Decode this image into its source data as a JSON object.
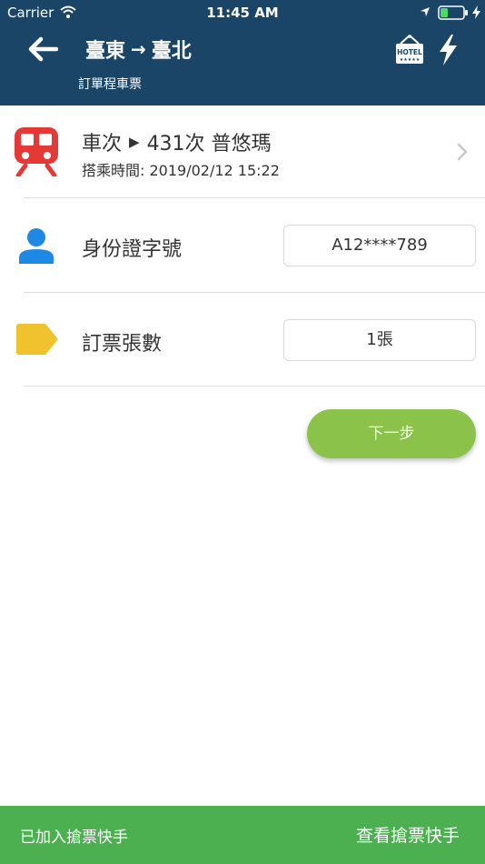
{
  "status_bar": {
    "carrier": "Carrier",
    "time": "11:45 AM"
  },
  "header": {
    "from": "臺東",
    "to": "臺北",
    "arrow": "→",
    "subtitle": "訂單程車票",
    "hotel_icon_text": "HOTEL",
    "background_color": "#1a4567"
  },
  "train": {
    "label": "車次",
    "number_name": "431次 普悠瑪",
    "ride_time_label": "搭乘時間:",
    "ride_time": "2019/02/12 15:22",
    "icon_color": "#e53935"
  },
  "id_field": {
    "label": "身份證字號",
    "value": "A12****789",
    "icon_color": "#1e88e5"
  },
  "count_field": {
    "label": "訂票張數",
    "value": "1張",
    "icon_color": "#f0c22e"
  },
  "next_button": {
    "label": "下一步",
    "color": "#8bc34a"
  },
  "bottom_bar": {
    "left_text": "已加入搶票快手",
    "right_text": "查看搶票快手",
    "color": "#4caf50"
  }
}
